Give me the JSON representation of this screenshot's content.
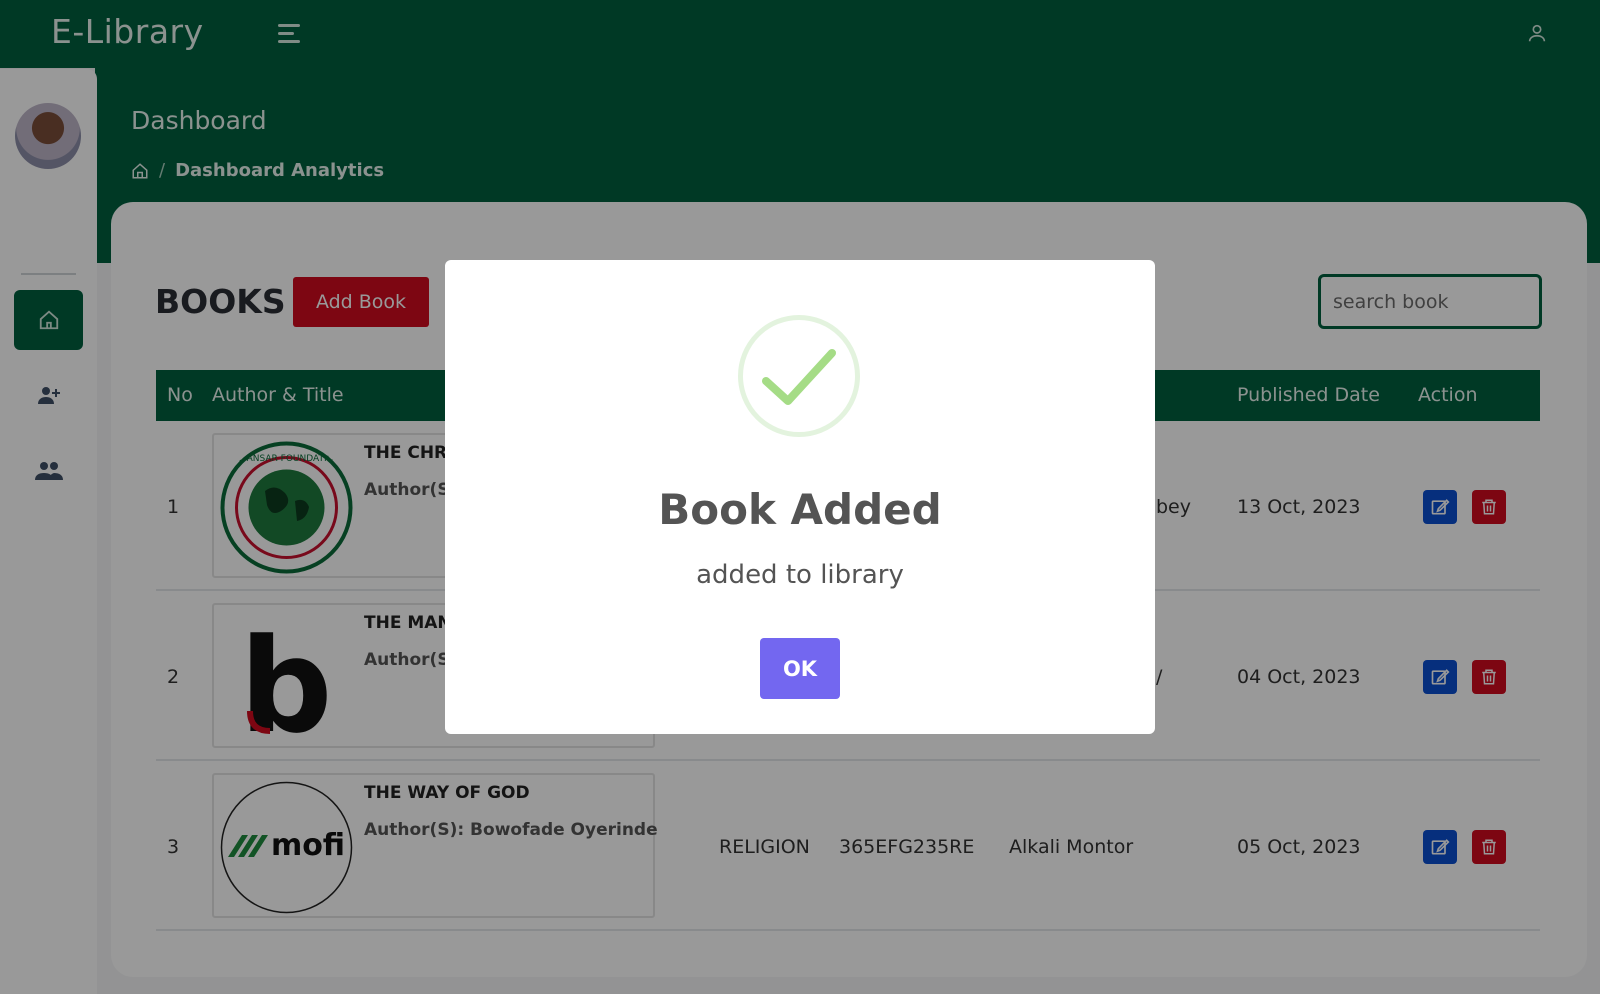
{
  "app": {
    "brand": "E-Library"
  },
  "header": {
    "page_title": "Dashboard",
    "breadcrumb_current": "Dashboard Analytics",
    "breadcrumb_separator": "/"
  },
  "books_section": {
    "title": "BOOKS",
    "add_button": "Add Book",
    "search_placeholder": "search book"
  },
  "table": {
    "headers": {
      "no": "No",
      "author_title": "Author & Title",
      "published": "Published Date",
      "action": "Action"
    },
    "rows": [
      {
        "no": "1",
        "title": "THE CHRC",
        "author": "Author(S)",
        "col_partial": "bey",
        "published": "13 Oct, 2023",
        "cover_text": "AL-ANSAR FOUNDATION"
      },
      {
        "no": "2",
        "title": "THE MAN",
        "author": "Author(S)",
        "col_partial": "/",
        "published": "04 Oct, 2023",
        "cover_text": "b"
      },
      {
        "no": "3",
        "title": "THE WAY OF GOD",
        "author": "Author(S): Bowofade Oyerinde",
        "category": "RELIGION",
        "isbn": "365EFG235RE",
        "publisher": "Alkali Montor",
        "published": "05 Oct, 2023",
        "cover_text": "mofi"
      }
    ]
  },
  "modal": {
    "title": "Book Added",
    "message": "added to library",
    "ok_label": "OK"
  },
  "colors": {
    "primary_green": "#005f3f",
    "danger_red": "#d00a1e",
    "edit_blue": "#0b4fd1",
    "ok_purple": "#7367f0",
    "success_green": "#a5dc86"
  },
  "icons": [
    "hamburger-icon",
    "user-icon",
    "home-icon",
    "add-user-icon",
    "users-icon",
    "edit-icon",
    "trash-icon",
    "check-icon"
  ]
}
